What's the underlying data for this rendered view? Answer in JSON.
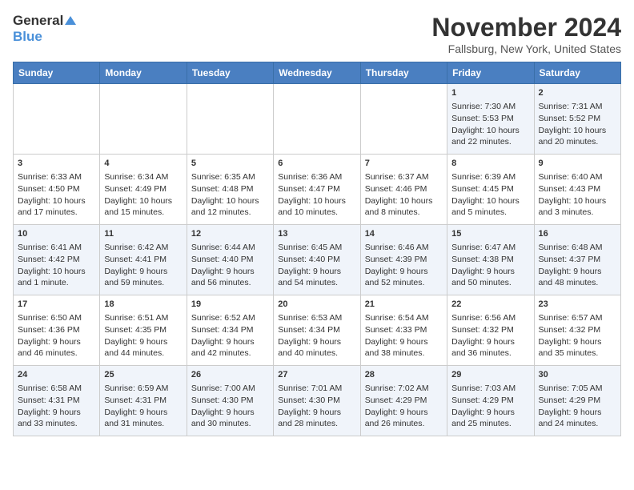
{
  "header": {
    "logo_general": "General",
    "logo_blue": "Blue",
    "month_title": "November 2024",
    "location": "Fallsburg, New York, United States"
  },
  "weekdays": [
    "Sunday",
    "Monday",
    "Tuesday",
    "Wednesday",
    "Thursday",
    "Friday",
    "Saturday"
  ],
  "weeks": [
    [
      {
        "day": "",
        "sunrise": "",
        "sunset": "",
        "daylight": ""
      },
      {
        "day": "",
        "sunrise": "",
        "sunset": "",
        "daylight": ""
      },
      {
        "day": "",
        "sunrise": "",
        "sunset": "",
        "daylight": ""
      },
      {
        "day": "",
        "sunrise": "",
        "sunset": "",
        "daylight": ""
      },
      {
        "day": "",
        "sunrise": "",
        "sunset": "",
        "daylight": ""
      },
      {
        "day": "1",
        "sunrise": "Sunrise: 7:30 AM",
        "sunset": "Sunset: 5:53 PM",
        "daylight": "Daylight: 10 hours and 22 minutes."
      },
      {
        "day": "2",
        "sunrise": "Sunrise: 7:31 AM",
        "sunset": "Sunset: 5:52 PM",
        "daylight": "Daylight: 10 hours and 20 minutes."
      }
    ],
    [
      {
        "day": "3",
        "sunrise": "Sunrise: 6:33 AM",
        "sunset": "Sunset: 4:50 PM",
        "daylight": "Daylight: 10 hours and 17 minutes."
      },
      {
        "day": "4",
        "sunrise": "Sunrise: 6:34 AM",
        "sunset": "Sunset: 4:49 PM",
        "daylight": "Daylight: 10 hours and 15 minutes."
      },
      {
        "day": "5",
        "sunrise": "Sunrise: 6:35 AM",
        "sunset": "Sunset: 4:48 PM",
        "daylight": "Daylight: 10 hours and 12 minutes."
      },
      {
        "day": "6",
        "sunrise": "Sunrise: 6:36 AM",
        "sunset": "Sunset: 4:47 PM",
        "daylight": "Daylight: 10 hours and 10 minutes."
      },
      {
        "day": "7",
        "sunrise": "Sunrise: 6:37 AM",
        "sunset": "Sunset: 4:46 PM",
        "daylight": "Daylight: 10 hours and 8 minutes."
      },
      {
        "day": "8",
        "sunrise": "Sunrise: 6:39 AM",
        "sunset": "Sunset: 4:45 PM",
        "daylight": "Daylight: 10 hours and 5 minutes."
      },
      {
        "day": "9",
        "sunrise": "Sunrise: 6:40 AM",
        "sunset": "Sunset: 4:43 PM",
        "daylight": "Daylight: 10 hours and 3 minutes."
      }
    ],
    [
      {
        "day": "10",
        "sunrise": "Sunrise: 6:41 AM",
        "sunset": "Sunset: 4:42 PM",
        "daylight": "Daylight: 10 hours and 1 minute."
      },
      {
        "day": "11",
        "sunrise": "Sunrise: 6:42 AM",
        "sunset": "Sunset: 4:41 PM",
        "daylight": "Daylight: 9 hours and 59 minutes."
      },
      {
        "day": "12",
        "sunrise": "Sunrise: 6:44 AM",
        "sunset": "Sunset: 4:40 PM",
        "daylight": "Daylight: 9 hours and 56 minutes."
      },
      {
        "day": "13",
        "sunrise": "Sunrise: 6:45 AM",
        "sunset": "Sunset: 4:40 PM",
        "daylight": "Daylight: 9 hours and 54 minutes."
      },
      {
        "day": "14",
        "sunrise": "Sunrise: 6:46 AM",
        "sunset": "Sunset: 4:39 PM",
        "daylight": "Daylight: 9 hours and 52 minutes."
      },
      {
        "day": "15",
        "sunrise": "Sunrise: 6:47 AM",
        "sunset": "Sunset: 4:38 PM",
        "daylight": "Daylight: 9 hours and 50 minutes."
      },
      {
        "day": "16",
        "sunrise": "Sunrise: 6:48 AM",
        "sunset": "Sunset: 4:37 PM",
        "daylight": "Daylight: 9 hours and 48 minutes."
      }
    ],
    [
      {
        "day": "17",
        "sunrise": "Sunrise: 6:50 AM",
        "sunset": "Sunset: 4:36 PM",
        "daylight": "Daylight: 9 hours and 46 minutes."
      },
      {
        "day": "18",
        "sunrise": "Sunrise: 6:51 AM",
        "sunset": "Sunset: 4:35 PM",
        "daylight": "Daylight: 9 hours and 44 minutes."
      },
      {
        "day": "19",
        "sunrise": "Sunrise: 6:52 AM",
        "sunset": "Sunset: 4:34 PM",
        "daylight": "Daylight: 9 hours and 42 minutes."
      },
      {
        "day": "20",
        "sunrise": "Sunrise: 6:53 AM",
        "sunset": "Sunset: 4:34 PM",
        "daylight": "Daylight: 9 hours and 40 minutes."
      },
      {
        "day": "21",
        "sunrise": "Sunrise: 6:54 AM",
        "sunset": "Sunset: 4:33 PM",
        "daylight": "Daylight: 9 hours and 38 minutes."
      },
      {
        "day": "22",
        "sunrise": "Sunrise: 6:56 AM",
        "sunset": "Sunset: 4:32 PM",
        "daylight": "Daylight: 9 hours and 36 minutes."
      },
      {
        "day": "23",
        "sunrise": "Sunrise: 6:57 AM",
        "sunset": "Sunset: 4:32 PM",
        "daylight": "Daylight: 9 hours and 35 minutes."
      }
    ],
    [
      {
        "day": "24",
        "sunrise": "Sunrise: 6:58 AM",
        "sunset": "Sunset: 4:31 PM",
        "daylight": "Daylight: 9 hours and 33 minutes."
      },
      {
        "day": "25",
        "sunrise": "Sunrise: 6:59 AM",
        "sunset": "Sunset: 4:31 PM",
        "daylight": "Daylight: 9 hours and 31 minutes."
      },
      {
        "day": "26",
        "sunrise": "Sunrise: 7:00 AM",
        "sunset": "Sunset: 4:30 PM",
        "daylight": "Daylight: 9 hours and 30 minutes."
      },
      {
        "day": "27",
        "sunrise": "Sunrise: 7:01 AM",
        "sunset": "Sunset: 4:30 PM",
        "daylight": "Daylight: 9 hours and 28 minutes."
      },
      {
        "day": "28",
        "sunrise": "Sunrise: 7:02 AM",
        "sunset": "Sunset: 4:29 PM",
        "daylight": "Daylight: 9 hours and 26 minutes."
      },
      {
        "day": "29",
        "sunrise": "Sunrise: 7:03 AM",
        "sunset": "Sunset: 4:29 PM",
        "daylight": "Daylight: 9 hours and 25 minutes."
      },
      {
        "day": "30",
        "sunrise": "Sunrise: 7:05 AM",
        "sunset": "Sunset: 4:29 PM",
        "daylight": "Daylight: 9 hours and 24 minutes."
      }
    ]
  ]
}
